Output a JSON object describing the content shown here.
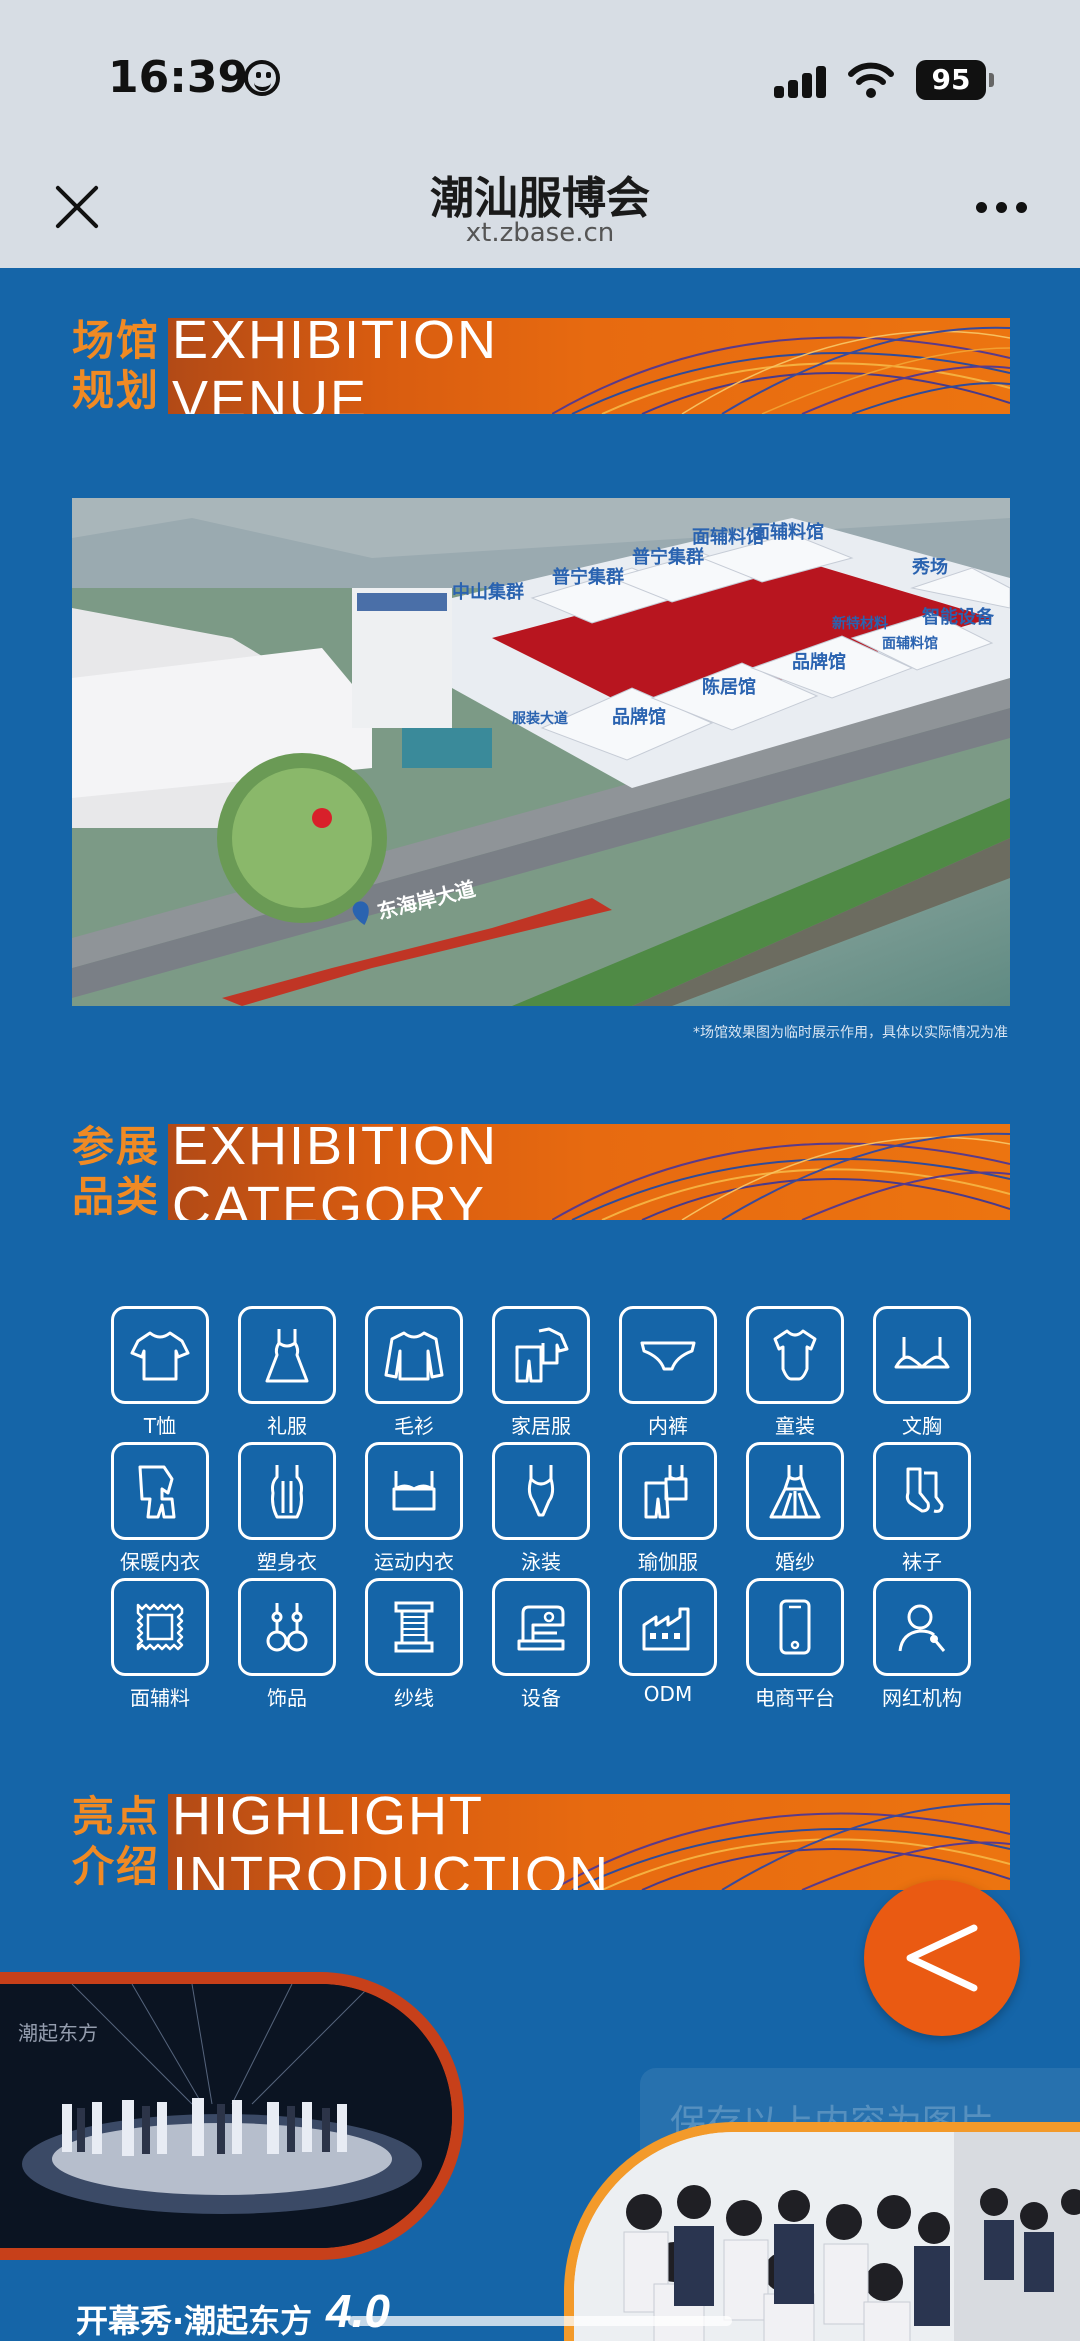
{
  "status_bar": {
    "time": "16:39",
    "battery": "95"
  },
  "browser": {
    "title": "潮汕服博会",
    "url": "xt.zbase.cn"
  },
  "sections": {
    "venue": {
      "zh_line1": "场馆",
      "zh_line2": "规划",
      "en_line1": "EXHIBITION",
      "en_line2": "VENUE"
    },
    "category": {
      "zh_line1": "参展",
      "zh_line2": "品类",
      "en_line1": "EXHIBITION",
      "en_line2": "CATEGORY"
    },
    "highlight": {
      "zh_line1": "亮点",
      "zh_line2": "介绍",
      "en_line1": "HIGHLIGHT",
      "en_line2": "INTRODUCTION"
    }
  },
  "venue_map": {
    "labels": [
      "面辅料馆",
      "秀场",
      "中山集群",
      "普宁集群",
      "普宁集群",
      "面辅料馆",
      "智能设备",
      "品牌馆",
      "陈居馆",
      "品牌馆",
      "新特材料",
      "面辅料馆",
      "服装大道",
      "东海岸大道"
    ],
    "note": "*场馆效果图为临时展示作用，具体以实际情况为准"
  },
  "categories": [
    {
      "label": "T恤",
      "icon": "tshirt-icon"
    },
    {
      "label": "礼服",
      "icon": "dress-icon"
    },
    {
      "label": "毛衫",
      "icon": "sweater-icon"
    },
    {
      "label": "家居服",
      "icon": "homewear-icon"
    },
    {
      "label": "内裤",
      "icon": "underwear-icon"
    },
    {
      "label": "童装",
      "icon": "babysuit-icon"
    },
    {
      "label": "文胸",
      "icon": "bra-icon"
    },
    {
      "label": "保暖内衣",
      "icon": "thermal-icon"
    },
    {
      "label": "塑身衣",
      "icon": "shapewear-icon"
    },
    {
      "label": "运动内衣",
      "icon": "sportsbra-icon"
    },
    {
      "label": "泳装",
      "icon": "swimsuit-icon"
    },
    {
      "label": "瑜伽服",
      "icon": "yoga-icon"
    },
    {
      "label": "婚纱",
      "icon": "weddingdress-icon"
    },
    {
      "label": "袜子",
      "icon": "socks-icon"
    },
    {
      "label": "面辅料",
      "icon": "fabric-icon"
    },
    {
      "label": "饰品",
      "icon": "earrings-icon"
    },
    {
      "label": "纱线",
      "icon": "yarn-icon"
    },
    {
      "label": "设备",
      "icon": "sewing-machine-icon"
    },
    {
      "label": "ODM",
      "icon": "factory-icon"
    },
    {
      "label": "电商平台",
      "icon": "phone-icon"
    },
    {
      "label": "网红机构",
      "icon": "influencer-icon"
    }
  ],
  "highlight": {
    "save_hint": "保存以上内容为图片",
    "caption": "开幕秀·潮起东方",
    "caption_num": "4.0"
  },
  "colors": {
    "background": "#1565a8",
    "accent_orange": "#ea5a12",
    "banner_text": "#f08a24"
  }
}
